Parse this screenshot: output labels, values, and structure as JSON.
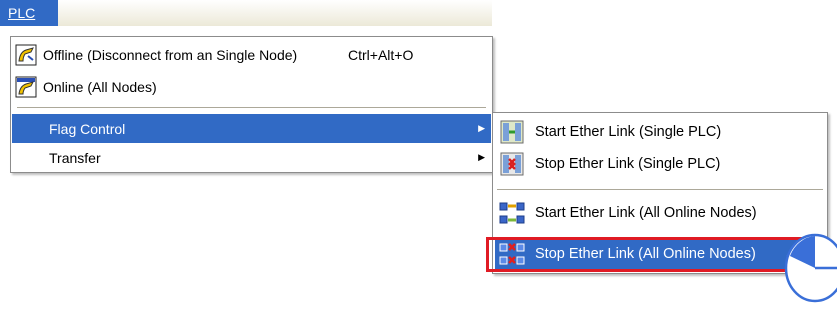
{
  "menubar": {
    "plc_label": "PLC"
  },
  "menu": {
    "items": [
      {
        "label": "Offline (Disconnect from an Single Node)",
        "shortcut": "Ctrl+Alt+O",
        "icon": "plc-offline-icon"
      },
      {
        "label": "Online (All Nodes)",
        "icon": "plc-online-icon"
      },
      {
        "label": "Flag Control",
        "has_submenu": true
      },
      {
        "label": "Transfer",
        "has_submenu": true
      }
    ]
  },
  "submenu": {
    "items": [
      {
        "label": "Start Ether Link (Single PLC)",
        "icon": "start-link-single-icon"
      },
      {
        "label": "Stop Ether Link (Single PLC)",
        "icon": "stop-link-single-icon"
      },
      {
        "label": "Start Ether Link (All Online Nodes)",
        "icon": "start-link-all-icon"
      },
      {
        "label": "Stop Ether Link (All Online Nodes)",
        "icon": "stop-link-all-icon"
      }
    ]
  },
  "colors": {
    "highlight": "#316ac5",
    "callout": "#e01b24",
    "pointer": "#3a6fd8"
  }
}
